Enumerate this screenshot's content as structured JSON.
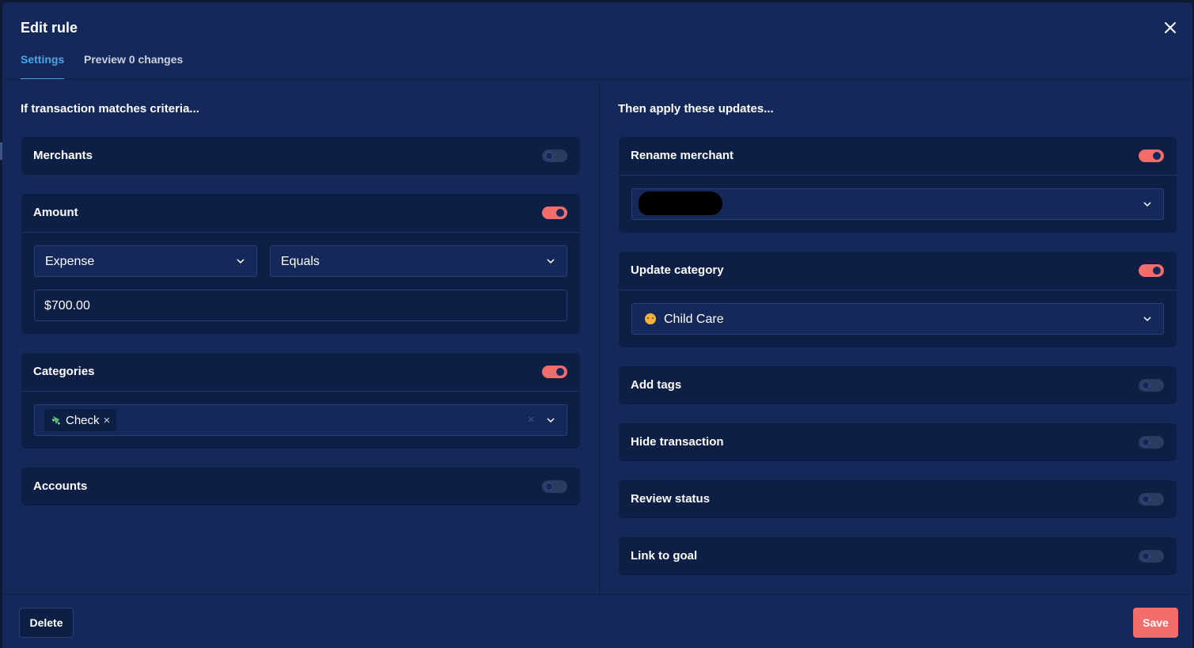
{
  "modal": {
    "title": "Edit rule"
  },
  "tabs": [
    {
      "label": "Settings",
      "active": true
    },
    {
      "label": "Preview 0 changes",
      "active": false
    }
  ],
  "criteria": {
    "heading": "If transaction matches criteria...",
    "merchants": {
      "label": "Merchants",
      "enabled": false
    },
    "amount": {
      "label": "Amount",
      "enabled": true,
      "type": "Expense",
      "operator": "Equals",
      "value": "$700.00"
    },
    "categories": {
      "label": "Categories",
      "enabled": true,
      "selected": [
        {
          "label": "Check",
          "icon": "money-with-wings-emoji"
        }
      ]
    },
    "accounts": {
      "label": "Accounts",
      "enabled": false
    }
  },
  "updates": {
    "heading": "Then apply these updates...",
    "rename_merchant": {
      "label": "Rename merchant",
      "enabled": true,
      "value": ""
    },
    "update_category": {
      "label": "Update category",
      "enabled": true,
      "value": "Child Care",
      "icon": "baby-emoji"
    },
    "add_tags": {
      "label": "Add tags",
      "enabled": false
    },
    "hide_transaction": {
      "label": "Hide transaction",
      "enabled": false
    },
    "review_status": {
      "label": "Review status",
      "enabled": false
    },
    "link_to_goal": {
      "label": "Link to goal",
      "enabled": false
    }
  },
  "footer": {
    "delete_label": "Delete",
    "save_label": "Save"
  },
  "colors": {
    "background": "#14295a",
    "card": "#0e1f45",
    "accent": "#f36d6d",
    "tab_active": "#4aa6e8"
  }
}
